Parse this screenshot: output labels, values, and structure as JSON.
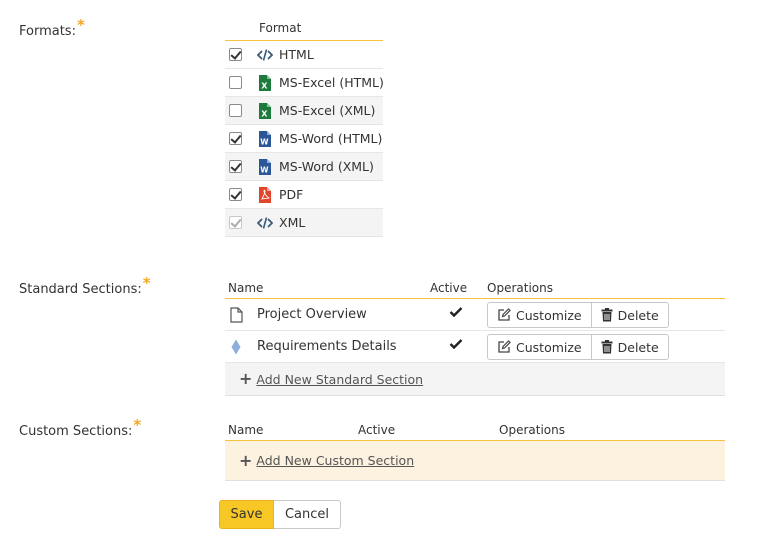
{
  "formats": {
    "label": "Formats:",
    "required_mark": "*",
    "column_header": "Format",
    "items": [
      {
        "name": "HTML",
        "checked": true,
        "disabled": false,
        "icon": "code-icon"
      },
      {
        "name": "MS-Excel (HTML)",
        "checked": false,
        "disabled": false,
        "icon": "excel-icon"
      },
      {
        "name": "MS-Excel (XML)",
        "checked": false,
        "disabled": false,
        "icon": "excel-icon"
      },
      {
        "name": "MS-Word (HTML)",
        "checked": true,
        "disabled": false,
        "icon": "word-icon"
      },
      {
        "name": "MS-Word (XML)",
        "checked": true,
        "disabled": false,
        "icon": "word-icon"
      },
      {
        "name": "PDF",
        "checked": true,
        "disabled": false,
        "icon": "pdf-icon"
      },
      {
        "name": "XML",
        "checked": true,
        "disabled": true,
        "icon": "code-icon"
      }
    ]
  },
  "standard_sections": {
    "label": "Standard Sections:",
    "required_mark": "*",
    "headers": {
      "name": "Name",
      "active": "Active",
      "operations": "Operations"
    },
    "rows": [
      {
        "name": "Project Overview",
        "icon": "document-icon",
        "active": true
      },
      {
        "name": "Requirements Details",
        "icon": "diamond-icon",
        "active": true
      }
    ],
    "customize_label": "Customize",
    "delete_label": "Delete",
    "add_label": "Add New Standard Section"
  },
  "custom_sections": {
    "label": "Custom Sections:",
    "required_mark": "*",
    "headers": {
      "name": "Name",
      "active": "Active",
      "operations": "Operations"
    },
    "add_label": "Add New Custom Section"
  },
  "buttons": {
    "save": "Save",
    "cancel": "Cancel"
  },
  "colors": {
    "accent": "#f7c726",
    "header_rule": "#f5c43c",
    "required": "#f5a623",
    "custom_add_bg": "#fdf1e0"
  }
}
